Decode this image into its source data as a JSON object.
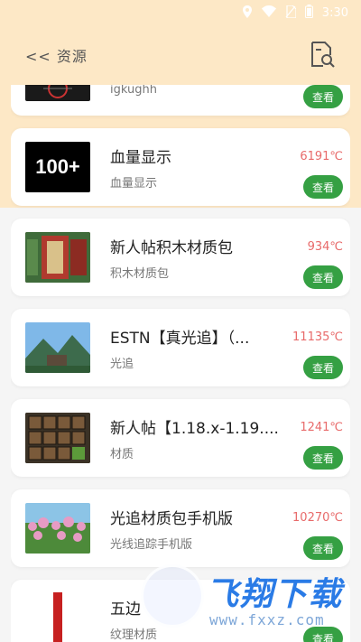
{
  "status_bar": {
    "time": "3:30",
    "icons": [
      "location-icon",
      "wifi-icon",
      "no-sim-icon",
      "battery-icon"
    ]
  },
  "header": {
    "back_label": "<< 资源",
    "action_icon": "search-document-icon"
  },
  "colors": {
    "header_bg": "#fde8c6",
    "accent_green": "#35a043",
    "temperature_red": "#e86a6a"
  },
  "items": [
    {
      "title": "",
      "subtitle": "igkughh",
      "temp": "",
      "button": "查看",
      "thumb": "logo-dark"
    },
    {
      "title": "血量显示",
      "subtitle": "血量显示",
      "temp": "6191℃",
      "button": "查看",
      "thumb": "100+"
    },
    {
      "title": "新人帖积木材质包",
      "subtitle": "积木材质包",
      "temp": "934℃",
      "button": "查看",
      "thumb": "bricks"
    },
    {
      "title": "ESTN【真光追】（...",
      "subtitle": "光追",
      "temp": "11135℃",
      "button": "查看",
      "thumb": "landscape"
    },
    {
      "title": "新人帖【1.18.x-1.19....",
      "subtitle": "材质",
      "temp": "1241℃",
      "button": "查看",
      "thumb": "inventory"
    },
    {
      "title": "光追材质包手机版",
      "subtitle": "光线追踪手机版",
      "temp": "10270℃",
      "button": "查看",
      "thumb": "flowers"
    },
    {
      "title": "五边",
      "subtitle": "纹理材质",
      "temp": "",
      "button": "查看",
      "thumb": "red-bar"
    }
  ],
  "watermark": {
    "brand": "飞翔下载",
    "url": "www.fxxz.com"
  }
}
